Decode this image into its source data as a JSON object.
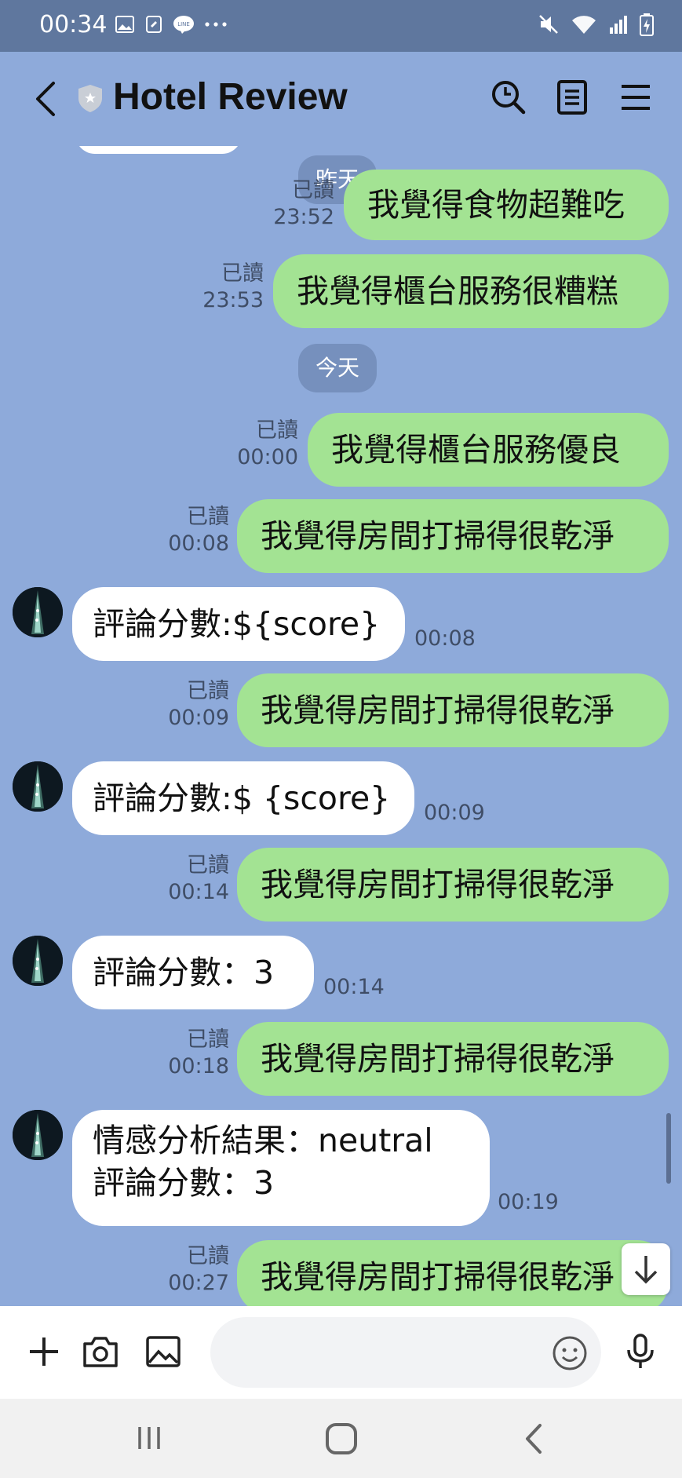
{
  "status_bar": {
    "time": "00:34"
  },
  "header": {
    "title": "Hotel Review"
  },
  "chat": {
    "dates": {
      "yesterday": "昨天",
      "today": "今天"
    },
    "messages": [
      {
        "dir": "out",
        "text": "我覺得食物超難吃",
        "read": "已讀",
        "time": "23:52"
      },
      {
        "dir": "out",
        "text": "我覺得櫃台服務很糟糕",
        "read": "已讀",
        "time": "23:53"
      },
      {
        "dir": "out",
        "text": "我覺得櫃台服務優良",
        "read": "已讀",
        "time": "00:00"
      },
      {
        "dir": "out",
        "text": "我覺得房間打掃得很乾淨",
        "read": "已讀",
        "time": "00:08"
      },
      {
        "dir": "in",
        "text": "評論分數:${score}",
        "time": "00:08"
      },
      {
        "dir": "out",
        "text": "我覺得房間打掃得很乾淨",
        "read": "已讀",
        "time": "00:09"
      },
      {
        "dir": "in",
        "text": "評論分數:$ {score}",
        "time": "00:09"
      },
      {
        "dir": "out",
        "text": "我覺得房間打掃得很乾淨",
        "read": "已讀",
        "time": "00:14"
      },
      {
        "dir": "in",
        "text": "評論分數：3",
        "time": "00:14"
      },
      {
        "dir": "out",
        "text": "我覺得房間打掃得很乾淨",
        "read": "已讀",
        "time": "00:18"
      },
      {
        "dir": "in",
        "text_line1": "情感分析結果：neutral",
        "text_line2": "評論分數：3",
        "time": "00:19"
      },
      {
        "dir": "out",
        "text": "我覺得房間打掃得很乾淨",
        "read": "已讀",
        "time": "00:27"
      }
    ]
  },
  "composer": {
    "placeholder": ""
  },
  "colors": {
    "chat_bg": "#8eaada",
    "out_bubble": "#a3e393",
    "in_bubble": "#ffffff",
    "status_bar": "#5f779e"
  },
  "icons": [
    "back-icon",
    "shield-icon",
    "search-icon",
    "notes-icon",
    "menu-icon",
    "plus-icon",
    "camera-icon",
    "image-icon",
    "emoji-icon",
    "mic-icon",
    "arrow-down-icon"
  ]
}
